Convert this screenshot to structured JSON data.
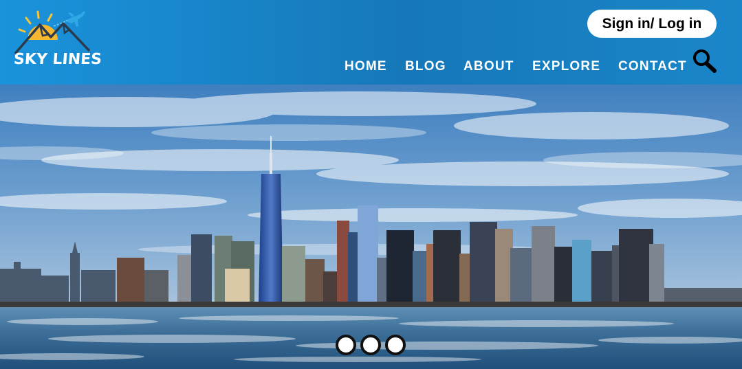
{
  "header": {
    "logo": {
      "text": "SKY LINES",
      "icon": "sun-mountains-plane-logo"
    },
    "signin_label": "Sign in/ Log in",
    "nav": [
      "HOME",
      "BLOG",
      "ABOUT",
      "EXPLORE",
      "CONTACT"
    ],
    "search_icon": "search-icon",
    "colors": {
      "header_start": "#1a93dc",
      "header_end": "#1678b8",
      "sun": "#f7b731"
    }
  },
  "hero": {
    "image": "city-skyline-over-water",
    "slider": {
      "count": 3,
      "active": 0
    }
  }
}
